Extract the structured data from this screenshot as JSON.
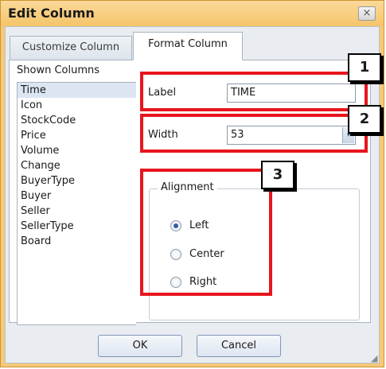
{
  "dialog": {
    "title": "Edit Column",
    "close_icon": "×"
  },
  "tabs": [
    {
      "label": "Customize Column",
      "active": false
    },
    {
      "label": "Format Column",
      "active": true
    }
  ],
  "shown_columns": {
    "label": "Shown Columns",
    "items": [
      "Time",
      "Icon",
      "StockCode",
      "Price",
      "Volume",
      "Change",
      "BuyerType",
      "Buyer",
      "Seller",
      "SellerType",
      "Board"
    ],
    "selected": "Time"
  },
  "fields": {
    "label": {
      "caption": "Label",
      "value": "TIME"
    },
    "width": {
      "caption": "Width",
      "value": "53",
      "spin_icon": "▾"
    }
  },
  "alignment": {
    "title": "Alignment",
    "options": [
      "Left",
      "Center",
      "Right"
    ],
    "selected": "Left"
  },
  "callouts": [
    "1",
    "2",
    "3"
  ],
  "buttons": {
    "ok": "OK",
    "cancel": "Cancel"
  },
  "colors": {
    "highlight": "#e8151d",
    "title_bar": "#f6c978"
  }
}
